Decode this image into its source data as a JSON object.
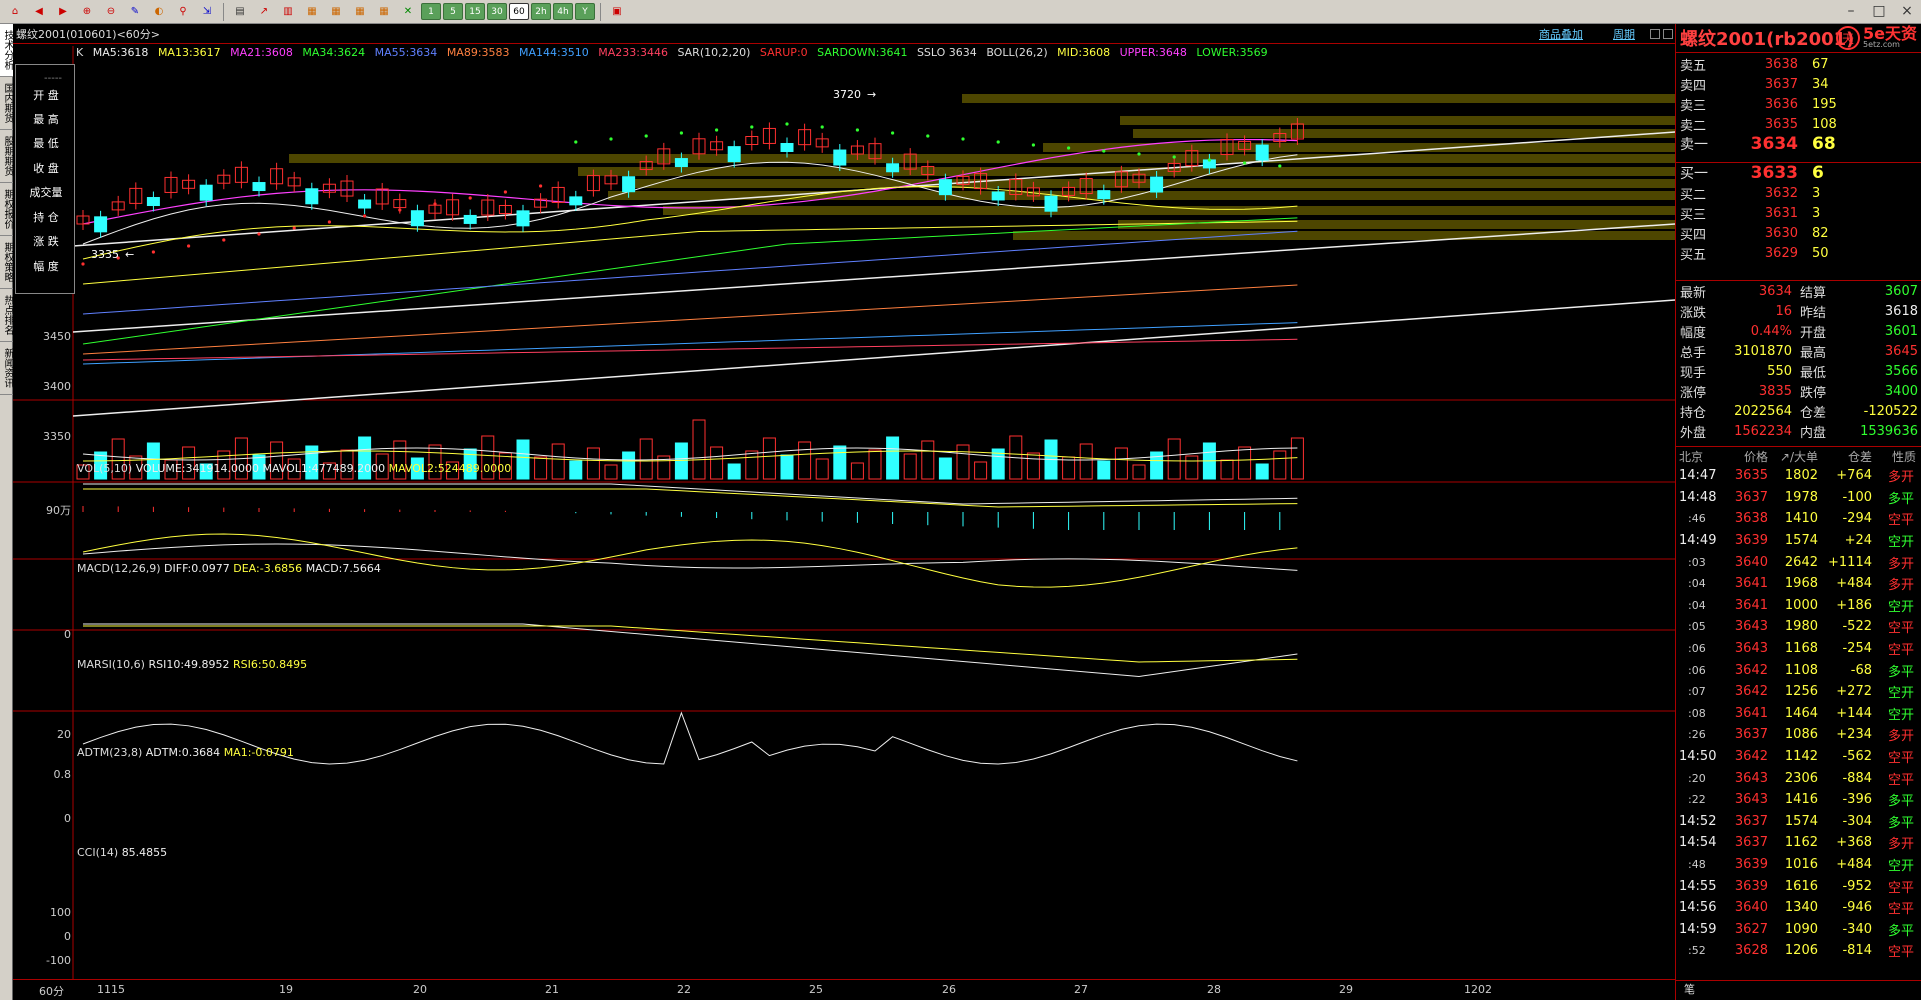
{
  "toolbar": {
    "icons": [
      "home-icon",
      "back-icon",
      "forward-icon",
      "zoom-in-icon",
      "zoom-out-icon",
      "pen-icon",
      "palette-icon",
      "brush-icon",
      "indicator-icon",
      "cursor-icon"
    ],
    "periods": [
      "1",
      "5",
      "15",
      "30",
      "60",
      "2h",
      "4h",
      "Y"
    ],
    "active_period": "60"
  },
  "sidebar_tabs": [
    "技术分析",
    "国内期货",
    "股期期货",
    "期权报价",
    "期权策略",
    "热点排名",
    "新闻资讯"
  ],
  "chart": {
    "title": "螺纹2001(010601)<60分>",
    "links": [
      "商品叠加",
      "周期"
    ],
    "ma_line": {
      "k": "K",
      "ma5": "MA5:3618",
      "ma13": "MA13:3617",
      "ma21": "MA21:3608",
      "ma34": "MA34:3624",
      "ma55": "MA55:3634",
      "ma89": "MA89:3583",
      "ma144": "MA144:3510",
      "ma233": "MA233:3446",
      "sar": "SAR(10,2,20)",
      "sarup": "SARUP:0",
      "sardown": "SARDOWN:3641",
      "sslo": "SSLO  3634",
      "boll": "BOLL(26,2)",
      "mid": "MID:3608",
      "upper": "UPPER:3648",
      "lower": "LOWER:3569"
    },
    "legend": [
      "开  盘",
      "最  高",
      "最  低",
      "收  盘",
      "成交量",
      "持  仓",
      "涨  跌",
      "幅  度"
    ],
    "legend_dash": "-----",
    "marks": {
      "high": "3720",
      "low": "3335"
    },
    "y_labels": [
      "3450",
      "3400",
      "3350"
    ],
    "vol": {
      "label": "VOL(5,10)",
      "volume": "VOLUME:341914.0000",
      "mavol1": "MAVOL1:477489.2000",
      "mavol2": "MAVOL2:524489.0000",
      "y": "90万"
    },
    "macd": {
      "label": "MACD(12,26,9)",
      "diff": "DIFF:0.0977",
      "dea": "DEA:-3.6856",
      "macd": "MACD:7.5664",
      "y": "0"
    },
    "rsi": {
      "label": "MARSI(10,6)",
      "rsi10": "RSI10:49.8952",
      "rsi6": "RSI6:50.8495",
      "y": "20"
    },
    "adtm": {
      "label": "ADTM(23,8)",
      "adtm": "ADTM:0.3684",
      "ma1": "MA1:-0.0791",
      "y1": "0.8",
      "y2": "0"
    },
    "cci": {
      "label": "CCI(14)",
      "value": "85.4855",
      "y1": "100",
      "y2": "0",
      "y3": "-100"
    },
    "xaxis": {
      "period": "60分",
      "dates": [
        "1115",
        "19",
        "20",
        "21",
        "22",
        "25",
        "26",
        "27",
        "28",
        "29",
        "1202"
      ]
    }
  },
  "right_panel": {
    "name": "螺纹2001(rb2001)",
    "brand": "5e天资",
    "brand_sub": "5etz.com",
    "asks": [
      {
        "label": "卖五",
        "price": "3638",
        "vol": "67"
      },
      {
        "label": "卖四",
        "price": "3637",
        "vol": "34"
      },
      {
        "label": "卖三",
        "price": "3636",
        "vol": "195"
      },
      {
        "label": "卖二",
        "price": "3635",
        "vol": "108"
      },
      {
        "label": "卖一",
        "price": "3634",
        "vol": "68"
      }
    ],
    "bids": [
      {
        "label": "买一",
        "price": "3633",
        "vol": "6"
      },
      {
        "label": "买二",
        "price": "3632",
        "vol": "3"
      },
      {
        "label": "买三",
        "price": "3631",
        "vol": "3"
      },
      {
        "label": "买四",
        "price": "3630",
        "vol": "82"
      },
      {
        "label": "买五",
        "price": "3629",
        "vol": "50"
      }
    ],
    "stats": [
      {
        "a": "最新",
        "b": "3634",
        "bc": "red",
        "c": "结算",
        "d": "3607",
        "dc": "grn"
      },
      {
        "a": "涨跌",
        "b": "16",
        "bc": "red",
        "c": "昨结",
        "d": "3618",
        "dc": "wht"
      },
      {
        "a": "幅度",
        "b": "0.44%",
        "bc": "red",
        "c": "开盘",
        "d": "3601",
        "dc": "grn"
      },
      {
        "a": "总手",
        "b": "3101870",
        "bc": "yel",
        "c": "最高",
        "d": "3645",
        "dc": "red"
      },
      {
        "a": "现手",
        "b": "550",
        "bc": "yel",
        "c": "最低",
        "d": "3566",
        "dc": "grn"
      },
      {
        "a": "涨停",
        "b": "3835",
        "bc": "red",
        "c": "跌停",
        "d": "3400",
        "dc": "grn"
      },
      {
        "a": "持仓",
        "b": "2022564",
        "bc": "yel",
        "c": "仓差",
        "d": "-120522",
        "dc": "yel"
      },
      {
        "a": "外盘",
        "b": "1562234",
        "bc": "red",
        "c": "内盘",
        "d": "1539636",
        "dc": "grn"
      }
    ],
    "tick_header": [
      "北京",
      "价格",
      "↗/大单",
      "仓差",
      "性质"
    ],
    "ticks": [
      {
        "t": "14:47",
        "s": 0,
        "p": "3635",
        "v": "1802",
        "o": "+764",
        "n": "多开",
        "nc": "red"
      },
      {
        "t": "14:48",
        "s": 0,
        "p": "3637",
        "v": "1978",
        "o": "-100",
        "n": "多平",
        "nc": "grn"
      },
      {
        "t": ":46",
        "s": 1,
        "p": "3638",
        "v": "1410",
        "o": "-294",
        "n": "空平",
        "nc": "red"
      },
      {
        "t": "14:49",
        "s": 0,
        "p": "3639",
        "v": "1574",
        "o": "+24",
        "n": "空开",
        "nc": "grn"
      },
      {
        "t": ":03",
        "s": 1,
        "p": "3640",
        "v": "2642",
        "o": "+1114",
        "n": "多开",
        "nc": "red"
      },
      {
        "t": ":04",
        "s": 1,
        "p": "3641",
        "v": "1968",
        "o": "+484",
        "n": "多开",
        "nc": "red"
      },
      {
        "t": ":04",
        "s": 1,
        "p": "3641",
        "v": "1000",
        "o": "+186",
        "n": "空开",
        "nc": "grn"
      },
      {
        "t": ":05",
        "s": 1,
        "p": "3643",
        "v": "1980",
        "o": "-522",
        "n": "空平",
        "nc": "red"
      },
      {
        "t": ":06",
        "s": 1,
        "p": "3643",
        "v": "1168",
        "o": "-254",
        "n": "空平",
        "nc": "red"
      },
      {
        "t": ":06",
        "s": 1,
        "p": "3642",
        "v": "1108",
        "o": "-68",
        "n": "多平",
        "nc": "grn"
      },
      {
        "t": ":07",
        "s": 1,
        "p": "3642",
        "v": "1256",
        "o": "+272",
        "n": "空开",
        "nc": "grn"
      },
      {
        "t": ":08",
        "s": 1,
        "p": "3641",
        "v": "1464",
        "o": "+144",
        "n": "空开",
        "nc": "grn"
      },
      {
        "t": ":26",
        "s": 1,
        "p": "3637",
        "v": "1086",
        "o": "+234",
        "n": "多开",
        "nc": "red"
      },
      {
        "t": "14:50",
        "s": 0,
        "p": "3642",
        "v": "1142",
        "o": "-562",
        "n": "空平",
        "nc": "red"
      },
      {
        "t": ":20",
        "s": 1,
        "p": "3643",
        "v": "2306",
        "o": "-884",
        "n": "空平",
        "nc": "red"
      },
      {
        "t": ":22",
        "s": 1,
        "p": "3643",
        "v": "1416",
        "o": "-396",
        "n": "多平",
        "nc": "grn"
      },
      {
        "t": "14:52",
        "s": 0,
        "p": "3637",
        "v": "1574",
        "o": "-304",
        "n": "多平",
        "nc": "grn"
      },
      {
        "t": "14:54",
        "s": 0,
        "p": "3637",
        "v": "1162",
        "o": "+368",
        "n": "多开",
        "nc": "red"
      },
      {
        "t": ":48",
        "s": 1,
        "p": "3639",
        "v": "1016",
        "o": "+484",
        "n": "空开",
        "nc": "grn"
      },
      {
        "t": "14:55",
        "s": 0,
        "p": "3639",
        "v": "1616",
        "o": "-952",
        "n": "空平",
        "nc": "red"
      },
      {
        "t": "14:56",
        "s": 0,
        "p": "3640",
        "v": "1340",
        "o": "-946",
        "n": "空平",
        "nc": "red"
      },
      {
        "t": "14:59",
        "s": 0,
        "p": "3627",
        "v": "1090",
        "o": "-340",
        "n": "多平",
        "nc": "grn"
      },
      {
        "t": ":52",
        "s": 1,
        "p": "3628",
        "v": "1206",
        "o": "-814",
        "n": "空平",
        "nc": "red"
      }
    ],
    "bottom_tab": "笔"
  }
}
